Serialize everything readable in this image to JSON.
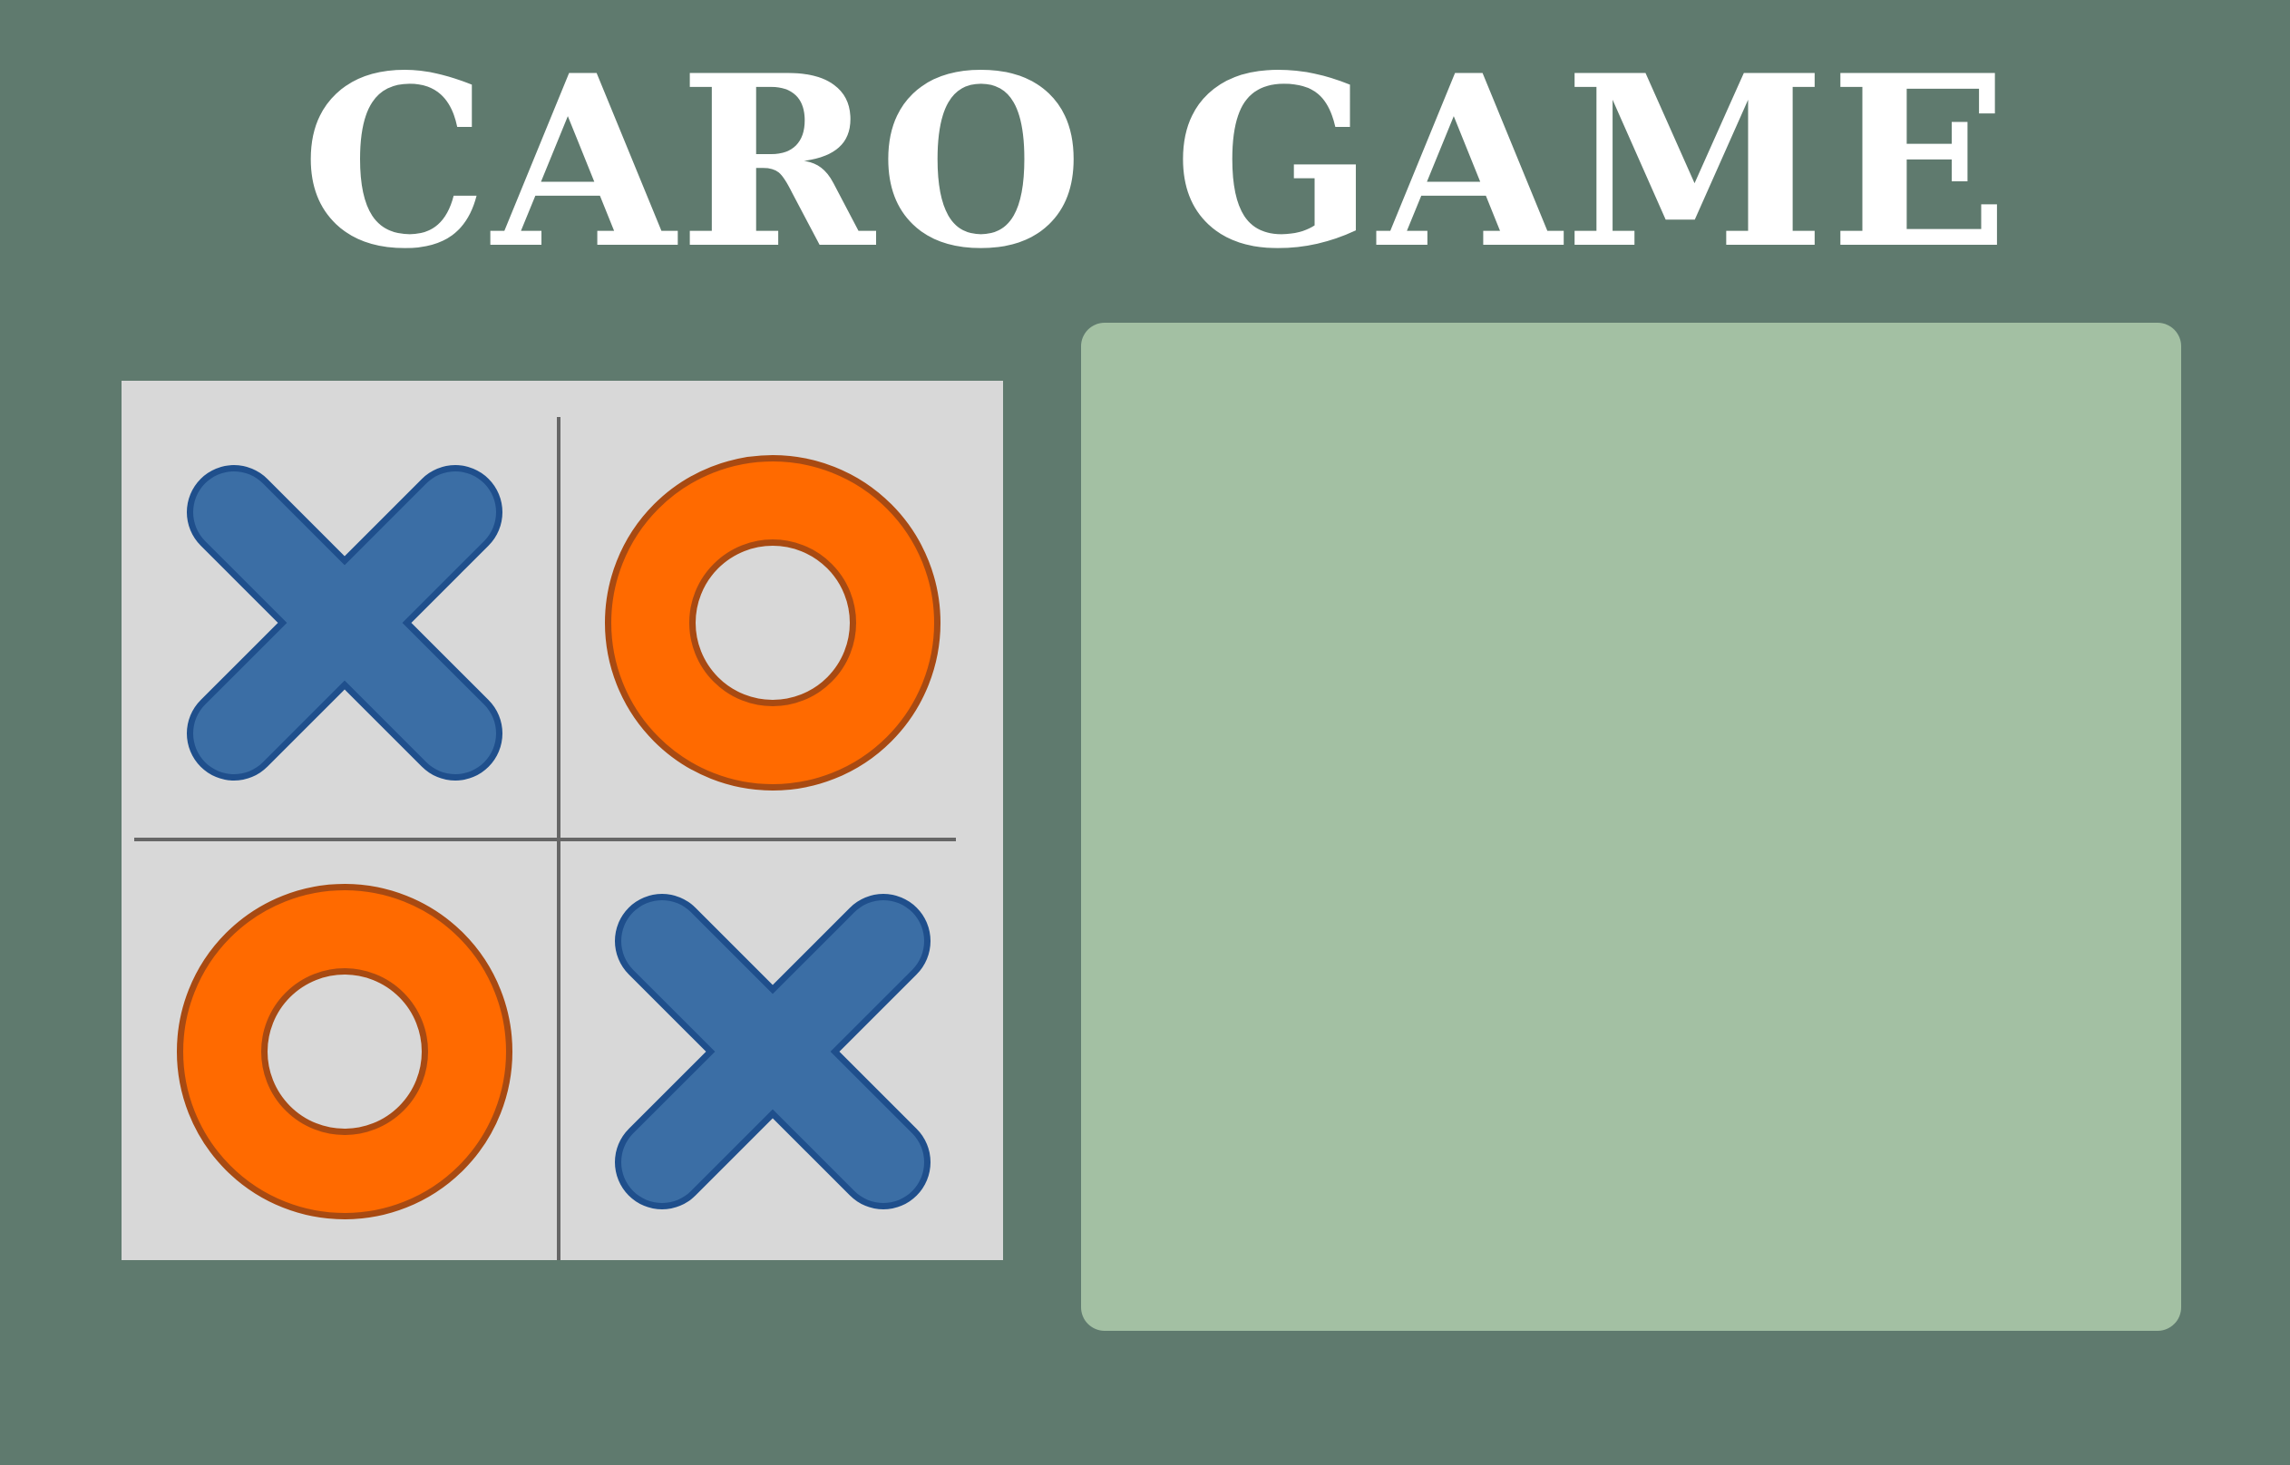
{
  "page": {
    "title": "CARO GAME"
  },
  "logo": {
    "board": [
      [
        "X",
        "O"
      ],
      [
        "O",
        "X"
      ]
    ],
    "x_icon": "x-mark-icon",
    "o_icon": "o-mark-icon"
  },
  "colors": {
    "background": "#5f7a6e",
    "title": "#ffffff",
    "logo_background": "#d8d8d8",
    "grid_line": "#666666",
    "x_fill": "#3b6ea5",
    "x_stroke": "#1f4f8c",
    "o_fill": "#ff6a00",
    "o_stroke": "#a84a12",
    "panel": "#a3c0a3"
  }
}
